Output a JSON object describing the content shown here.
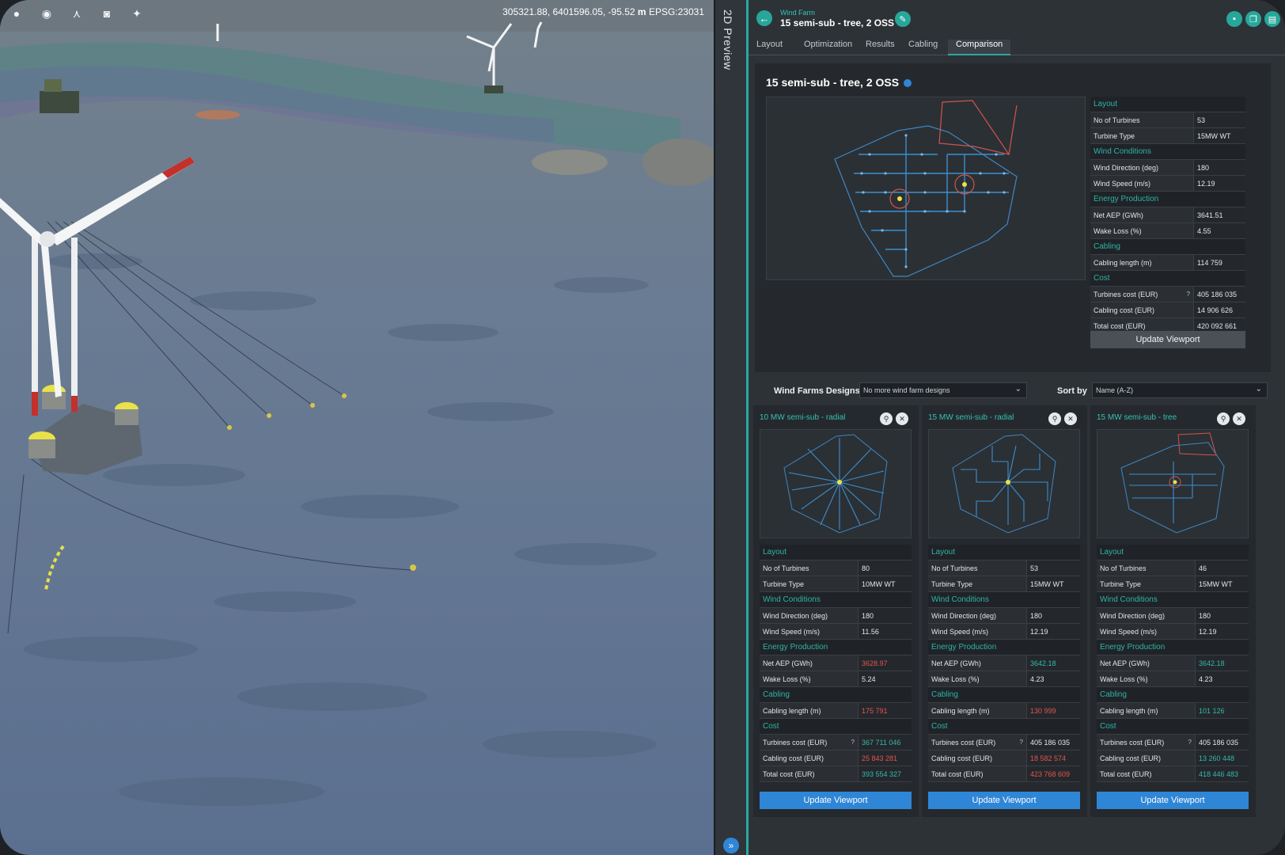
{
  "viewport": {
    "coordinates": "305321.88, 6401596.05, -95.52",
    "coordinates_unit": "m",
    "crs": "EPSG:23031"
  },
  "preview_strip": {
    "label": "2D Preview"
  },
  "header": {
    "subtitle": "Wind Farm",
    "title": "15 semi-sub - tree, 2 OSS"
  },
  "tabs": [
    "Layout",
    "Optimization",
    "Results",
    "Cabling",
    "Comparison"
  ],
  "active_tab": "Comparison",
  "main": {
    "title": "15 semi-sub - tree, 2 OSS",
    "sections": {
      "layout": "Layout",
      "wind": "Wind Conditions",
      "energy": "Energy Production",
      "cabling": "Cabling",
      "cost": "Cost"
    },
    "labels": {
      "turbines": "No of Turbines",
      "turbine_type": "Turbine Type",
      "wind_direction": "Wind Direction (deg)",
      "wind_speed": "Wind Speed (m/s)",
      "net_aep": "Net AEP (GWh)",
      "wake_loss": "Wake Loss (%)",
      "cabling_length": "Cabling length (m)",
      "turbines_cost": "Turbines cost (EUR)",
      "cabling_cost": "Cabling cost (EUR)",
      "total_cost": "Total cost (EUR)"
    },
    "values": {
      "turbines": "53",
      "turbine_type": "15MW WT",
      "wind_direction": "180",
      "wind_speed": "12.19",
      "net_aep": "3641.51",
      "wake_loss": "4.55",
      "cabling_length": "114 759",
      "turbines_cost": "405 186 035",
      "cabling_cost": "14 906 626",
      "total_cost": "420 092 661"
    },
    "update_label": "Update Viewport",
    "help_mark": "?"
  },
  "designs": {
    "label": "Wind Farms Designs",
    "select_value": "No more wind farm designs",
    "sort_label": "Sort by",
    "sort_value": "Name (A-Z)"
  },
  "cards": [
    {
      "title": "10 MW semi-sub - radial",
      "values": {
        "turbines": "80",
        "turbine_type": "10MW WT",
        "wind_direction": "180",
        "wind_speed": "11.56",
        "net_aep": "3628.97",
        "wake_loss": "5.24",
        "cabling_length": "175 791",
        "turbines_cost": "367 711 046",
        "cabling_cost": "25 843 281",
        "total_cost": "393 554 327"
      },
      "update_label": "Update Viewport"
    },
    {
      "title": "15 MW semi-sub - radial",
      "values": {
        "turbines": "53",
        "turbine_type": "15MW WT",
        "wind_direction": "180",
        "wind_speed": "12.19",
        "net_aep": "3642.18",
        "wake_loss": "4.23",
        "cabling_length": "130 999",
        "turbines_cost": "405 186 035",
        "cabling_cost": "18 582 574",
        "total_cost": "423 768 609"
      },
      "update_label": "Update Viewport"
    },
    {
      "title": "15 MW semi-sub - tree",
      "values": {
        "turbines": "46",
        "turbine_type": "15MW WT",
        "wind_direction": "180",
        "wind_speed": "12.19",
        "net_aep": "3642.18",
        "wake_loss": "4.23",
        "cabling_length": "101 126",
        "turbines_cost": "405 186 035",
        "cabling_cost": "13 260 448",
        "total_cost": "418 446 483"
      },
      "update_label": "Update Viewport"
    }
  ],
  "colors": {
    "accent": "#2aa9a0",
    "primary_button": "#2f86d6",
    "worse_value": "#e2554e",
    "better_value": "#35b8a9"
  },
  "icons": {
    "toolbar": [
      "sun-icon",
      "globe-icon",
      "measure-icon",
      "camera-icon",
      "sparkle-icon"
    ],
    "header": [
      "back-arrow-icon",
      "pencil-icon",
      "save-icon",
      "duplicate-icon",
      "export-icon"
    ],
    "card": [
      "pin-icon",
      "close-icon"
    ]
  }
}
